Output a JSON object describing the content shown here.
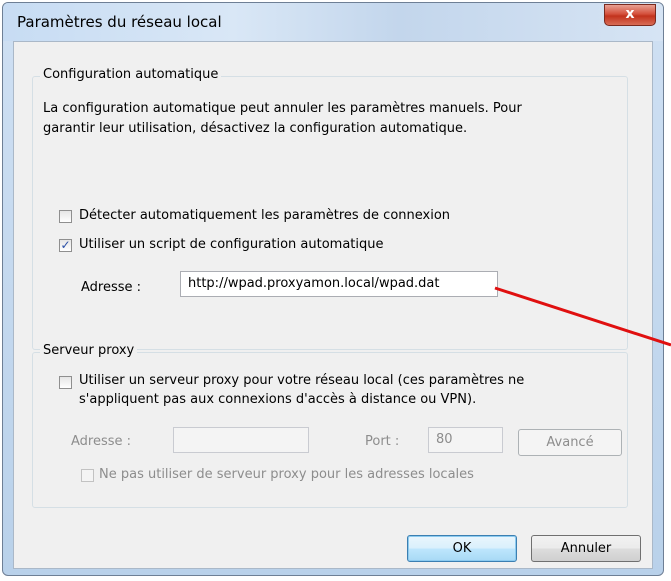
{
  "window": {
    "title": "Paramètres du réseau local",
    "close_glyph": "x"
  },
  "auto_config": {
    "legend": "Configuration automatique",
    "description_line1": "La configuration automatique peut annuler les paramètres manuels. Pour",
    "description_line2": "garantir leur utilisation, désactivez la configuration automatique.",
    "detect_label": "Détecter automatiquement les paramètres de connexion",
    "detect_checked": false,
    "script_label": "Utiliser un script de configuration automatique",
    "script_checked": true,
    "address_label": "Adresse :",
    "address_value": "http://wpad.proxyamon.local/wpad.dat"
  },
  "proxy": {
    "legend": "Serveur proxy",
    "use_proxy_line1": "Utiliser un serveur proxy pour votre réseau local (ces paramètres ne",
    "use_proxy_line2": "s'appliquent pas aux connexions d'accès à distance ou VPN).",
    "use_proxy_checked": false,
    "address_label": "Adresse :",
    "address_value": "",
    "port_label": "Port :",
    "port_value": "80",
    "advanced_label": "Avancé",
    "bypass_label": "Ne pas utiliser de serveur proxy pour les adresses locales",
    "bypass_checked": false
  },
  "buttons": {
    "ok": "OK",
    "cancel": "Annuler"
  },
  "annotation": {
    "arrow_color": "#e01010"
  }
}
